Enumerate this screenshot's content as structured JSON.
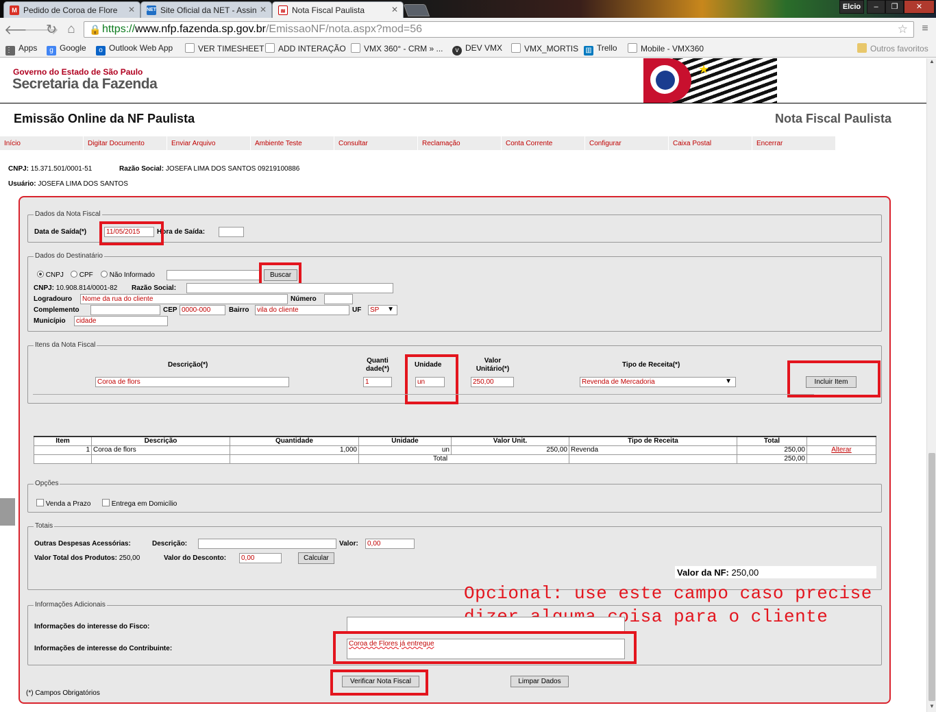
{
  "browser": {
    "tabs": [
      {
        "label": "Pedido de Coroa de Flore",
        "icon": "gmail-icon"
      },
      {
        "label": "Site Oficial da NET - Assin",
        "icon": "net-icon"
      },
      {
        "label": "Nota Fiscal Paulista",
        "icon": "nfp-icon"
      }
    ],
    "user": "Elcio",
    "window_controls": {
      "minimize": "‒",
      "restore": "❐",
      "close": "✕"
    },
    "url_scheme": "https://",
    "url_host": "www.nfp.fazenda.sp.gov.br",
    "url_path": "/EmissaoNF/nota.aspx?mod=56",
    "bookmarks": [
      "Apps",
      "Google",
      "Outlook Web App",
      "VER TIMESHEET",
      "ADD INTERAÇÃO",
      "VMX 360° - CRM » ...",
      "DEV VMX",
      "VMX_MORTIS",
      "Trello",
      "Mobile - VMX360"
    ],
    "other_bookmarks": "Outros favoritos"
  },
  "header": {
    "gov": "Governo do Estado de São Paulo",
    "secretaria": "Secretaria da Fazenda",
    "title": "Emissão Online da NF Paulista",
    "brand": "Nota Fiscal Paulista"
  },
  "menu": [
    "Início",
    "Digitar Documento",
    "Enviar Arquivo",
    "Ambiente Teste",
    "Consultar",
    "Reclamação",
    "Conta Corrente",
    "Configurar",
    "Caixa Postal",
    "Encerrar"
  ],
  "info": {
    "cnpj_label": "CNPJ:",
    "cnpj": "15.371.501/0001-51",
    "razao_label": "Razão Social:",
    "razao": "JOSEFA LIMA DOS SANTOS 09219100886",
    "usuario_label": "Usuário:",
    "usuario": "JOSEFA LIMA DOS SANTOS"
  },
  "dados_nota": {
    "legend": "Dados da Nota Fiscal",
    "data_label": "Data de Saída(*)",
    "data_value": "11/05/2015",
    "hora_label": "Hora de Saída:",
    "hora_value": ""
  },
  "destinatario": {
    "legend": "Dados do Destinatário",
    "opt_cnpj": "CNPJ",
    "opt_cpf": "CPF",
    "opt_none": "Não Informado",
    "busca_value": "",
    "buscar": "Buscar",
    "cnpj_label": "CNPJ:",
    "cnpj": "10.908.814/0001-82",
    "razao_label": "Razão Social:",
    "razao_value": "",
    "logradouro_label": "Logradouro",
    "logradouro_value": "Nome da rua do cliente",
    "numero_label": "Número",
    "numero_value": "",
    "complemento_label": "Complemento",
    "complemento_value": "",
    "cep_label": "CEP",
    "cep_value": "0000-000",
    "bairro_label": "Bairro",
    "bairro_value": "vila do cliente",
    "uf_label": "UF",
    "uf_value": "SP",
    "municipio_label": "Município",
    "municipio_value": "cidade"
  },
  "itens": {
    "legend": "Itens da Nota Fiscal",
    "desc_label": "Descrição(*)",
    "desc_value": "Coroa de flors",
    "qtd_label_1": "Quanti",
    "qtd_label_2": "dade(*)",
    "qtd_value": "1",
    "un_label": "Unidade",
    "un_value": "un",
    "valor_label_1": "Valor",
    "valor_label_2": "Unitário(*)",
    "valor_value": "250,00",
    "tipo_label": "Tipo de Receita(*)",
    "tipo_value": "Revenda de Mercadoria",
    "incluir": "Incluir Item"
  },
  "tabela": {
    "headers": [
      "Item",
      "Descrição",
      "Quantidade",
      "Unidade",
      "Valor Unit.",
      "Tipo de Receita",
      "Total",
      ""
    ],
    "row": {
      "item": "1",
      "desc": "Coroa de flors",
      "qtd": "1,000",
      "un": "un",
      "valor": "250,00",
      "tipo": "Revenda",
      "total": "250,00",
      "acao": "Alterar"
    },
    "total_label": "Total",
    "total_value": "250,00"
  },
  "opcoes": {
    "legend": "Opções",
    "venda_prazo": "Venda a Prazo",
    "entrega": "Entrega em Domicílio"
  },
  "totais": {
    "legend": "Totais",
    "outras_label": "Outras Despesas Acessórias:",
    "desc_label": "Descrição:",
    "desc_value": "",
    "valor_label": "Valor:",
    "valor_value": "0,00",
    "produtos_label": "Valor Total dos Produtos:",
    "produtos_value": "250,00",
    "desconto_label": "Valor do Desconto:",
    "desconto_value": "0,00",
    "calcular": "Calcular",
    "nf_label": "Valor da NF:",
    "nf_value": "250,00"
  },
  "annotation": {
    "line1": "Opcional: use este campo caso precise",
    "line2": "dizer alguma coisa para o cliente"
  },
  "adicionais": {
    "legend": "Informações Adicionais",
    "fisco_label": "Informações do interesse do Fisco:",
    "fisco_value": "",
    "contrib_label": "Informações de interesse do Contribuinte:",
    "contrib_value": "Coroa de Flores já entregue"
  },
  "acoes": {
    "verificar": "Verificar Nota Fiscal",
    "limpar": "Limpar Dados",
    "obrigatorios": "(*) Campos Obrigatórios"
  }
}
